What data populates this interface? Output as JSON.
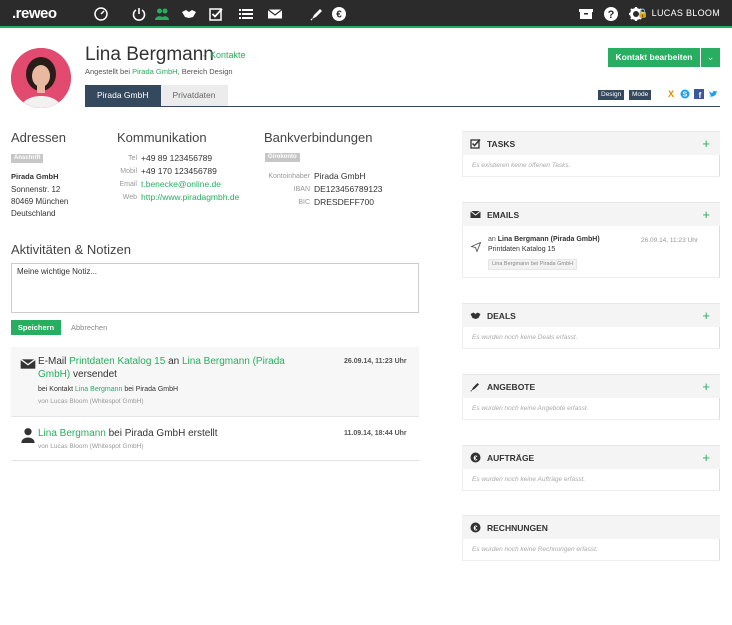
{
  "app": {
    "logo": "reweo",
    "user": "LUCAS BLOOM"
  },
  "contact": {
    "name": "Lina Bergmann",
    "breadcrumb": "Kontakte",
    "subtitle_prefix": "Angestellt bei",
    "company": "Pirada GmbH",
    "subtitle_suffix": ", Bereich Design",
    "tabs": [
      "Pirada GmbH",
      "Privatdaten"
    ],
    "edit_button": "Kontakt bearbeiten",
    "tags": [
      "Design",
      "Mode"
    ]
  },
  "addresses": {
    "title": "Adressen",
    "badge": "Anschrift",
    "company": "Pirada GmbH",
    "street": "Sonnenstr. 12",
    "city": "80469 München",
    "country": "Deutschland"
  },
  "communication": {
    "title": "Kommunikation",
    "rows": [
      {
        "label": "Tel",
        "value": "+49 89 123456789"
      },
      {
        "label": "Mobil",
        "value": "+49 170 123456789"
      },
      {
        "label": "Email",
        "value": "t.benecke@online.de"
      },
      {
        "label": "Web",
        "value": "http://www.piradagmbh.de"
      }
    ]
  },
  "bank": {
    "title": "Bankverbindungen",
    "badge": "Girokonto",
    "rows": [
      {
        "label": "Kontoinhaber",
        "value": "Pirada GmbH"
      },
      {
        "label": "IBAN",
        "value": "DE123456789123"
      },
      {
        "label": "BIC",
        "value": "DRESDEFF700"
      }
    ]
  },
  "activities": {
    "title": "Aktivitäten & Notizen",
    "note_text": "Meine wichtige Notiz...",
    "save": "Speichern",
    "cancel": "Abbrechen",
    "items": [
      {
        "t1": "E-Mail ",
        "t2": "Printdaten Katalog 15",
        "t3": " an ",
        "t4": "Lina Bergmann (Pirada GmbH)",
        "t5": " versendet",
        "date": "26.09.14, 11:23 Uhr",
        "sub1": "bei Kontakt ",
        "sub2": "Lina Bergmann",
        "sub3": " bei Pirada GmbH",
        "by": "von Lucas Bloom (Whitespot GmbH)"
      },
      {
        "t1": "Lina Bergmann",
        "t2": " bei Pirada GmbH erstellt",
        "date": "11.09.14, 18:44 Uhr",
        "by": "von Lucas Bloom (Whitespot GmbH)"
      }
    ]
  },
  "panels": {
    "tasks": {
      "title": "TASKS",
      "empty": "Es existieren keine offenen Tasks."
    },
    "emails": {
      "title": "EMAILS",
      "item_prefix": "an",
      "item_to": "Lina Bergmann (Pirada GmbH)",
      "item_subject": "Printdaten Katalog 15",
      "item_date": "26.09.14, 11:23 Uhr",
      "item_tag1": "Lina Bergmann",
      "item_tag2": " bei ",
      "item_tag3": "Pirada GmbH"
    },
    "deals": {
      "title": "DEALS",
      "empty": "Es wurden noch keine Deals erfasst."
    },
    "angebote": {
      "title": "ANGEBOTE",
      "empty": "Es wurden noch keine Angebote erfasst."
    },
    "auftraege": {
      "title": "AUFTRÄGE",
      "empty": "Es wurden noch keine Aufträge erfasst."
    },
    "rechnungen": {
      "title": "RECHNUNGEN",
      "empty": "Es wurden noch keine Rechnungen erfasst."
    }
  },
  "colors": {
    "accent": "#27ae60",
    "dark": "#34495e",
    "topbar": "#2b2b2b"
  }
}
